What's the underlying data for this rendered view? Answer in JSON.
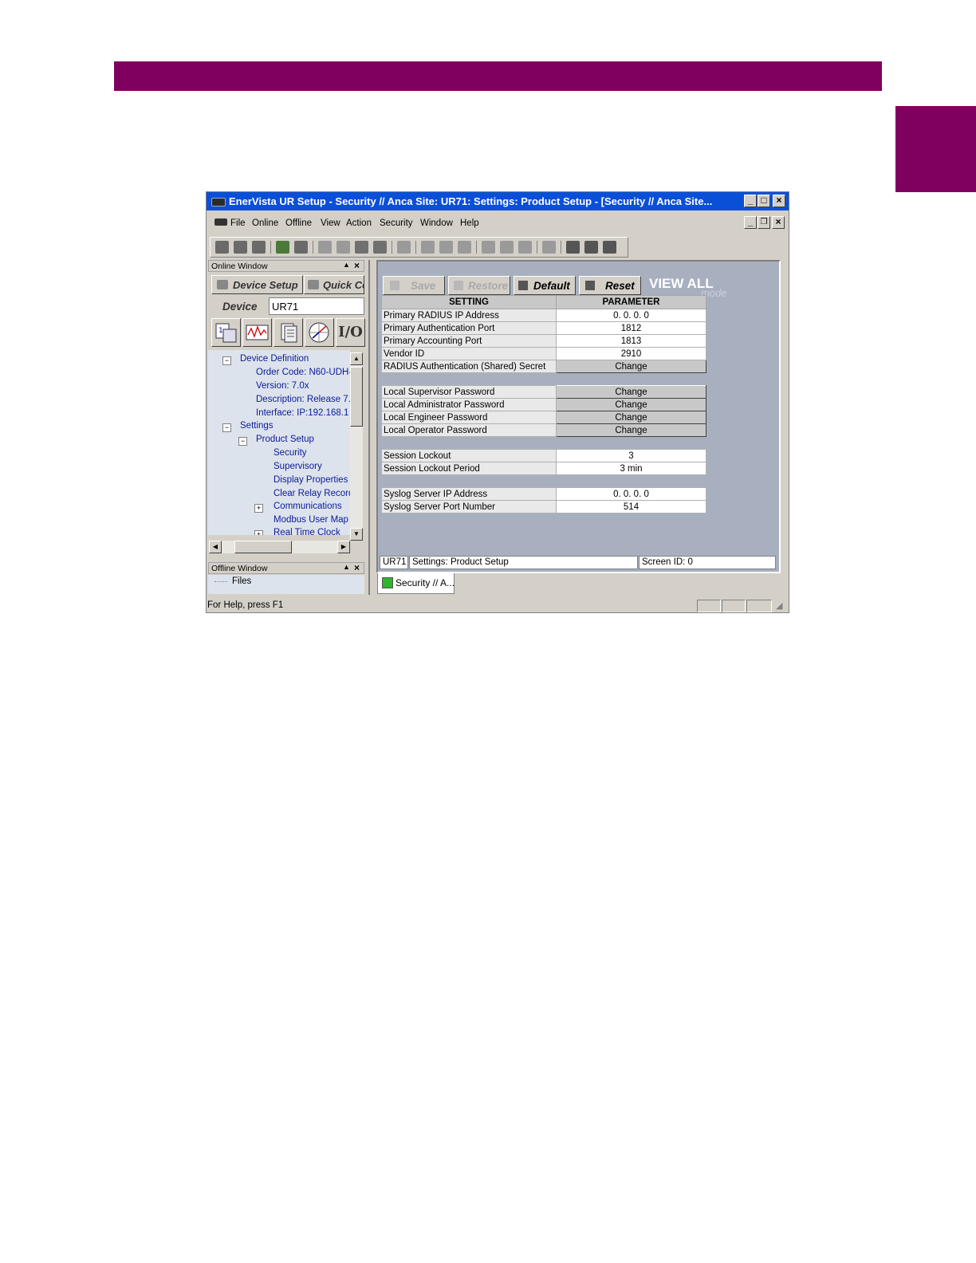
{
  "window": {
    "title": "EnerVista UR Setup  - Security // Anca Site: UR71: Settings: Product Setup - [Security // Anca Site..."
  },
  "menu": [
    "File",
    "Online",
    "Offline",
    "View",
    "Action",
    "Security",
    "Window",
    "Help"
  ],
  "online_window": {
    "title": "Online Window",
    "device_setup_label": "Device Setup",
    "quick_connect_label": "Quick Co",
    "device_label": "Device",
    "device_value": "UR71",
    "io_label": "I/O",
    "tree": {
      "device_definition": "Device Definition",
      "order_code": "Order Code: N60-UDH-",
      "version": "Version: 7.0x",
      "description": "Description: Release 7.",
      "interface": "Interface:  IP:192.168.1",
      "settings": "Settings",
      "product_setup": "Product Setup",
      "security": "Security",
      "supervisory": "Supervisory",
      "display_properties": "Display Properties",
      "clear_relay_records": "Clear Relay Record",
      "communications": "Communications",
      "modbus_user_map": "Modbus User Map",
      "real_time_clock": "Real Time Clock"
    }
  },
  "offline_window": {
    "title": "Offline Window",
    "files": "Files"
  },
  "settings_panel": {
    "save": "Save",
    "restore": "Restore",
    "default": "Default",
    "reset": "Reset",
    "view_all": "VIEW ALL",
    "mode": "mode",
    "col_setting": "SETTING",
    "col_parameter": "PARAMETER",
    "rows": {
      "r1": {
        "label": "Primary RADIUS IP Address",
        "value": "0. 0. 0. 0"
      },
      "r2": {
        "label": "Primary Authentication Port",
        "value": "1812"
      },
      "r3": {
        "label": "Primary Accounting Port",
        "value": "1813"
      },
      "r4": {
        "label": "Vendor ID",
        "value": "2910"
      },
      "r5": {
        "label": "RADIUS Authentication (Shared) Secret",
        "value": "Change"
      },
      "r6": {
        "label": "Local Supervisor Password",
        "value": "Change"
      },
      "r7": {
        "label": "Local Administrator Password",
        "value": "Change"
      },
      "r8": {
        "label": "Local Engineer Password",
        "value": "Change"
      },
      "r9": {
        "label": "Local Operator Password",
        "value": "Change"
      },
      "r10": {
        "label": "Session Lockout",
        "value": "3"
      },
      "r11": {
        "label": "Session Lockout Period",
        "value": "3 min"
      },
      "r12": {
        "label": "Syslog Server IP Address",
        "value": "0. 0. 0. 0"
      },
      "r13": {
        "label": "Syslog Server Port Number",
        "value": "514"
      }
    },
    "status_device": "UR71",
    "status_path": "Settings: Product Setup",
    "status_screen": "Screen ID: 0",
    "tab_label": "Security // A..."
  },
  "status_bar": {
    "help": "For Help, press F1"
  },
  "colors": {
    "brand": "#800060",
    "titlebar": "#0a4fd8",
    "tree_text": "#0a1a9a"
  }
}
